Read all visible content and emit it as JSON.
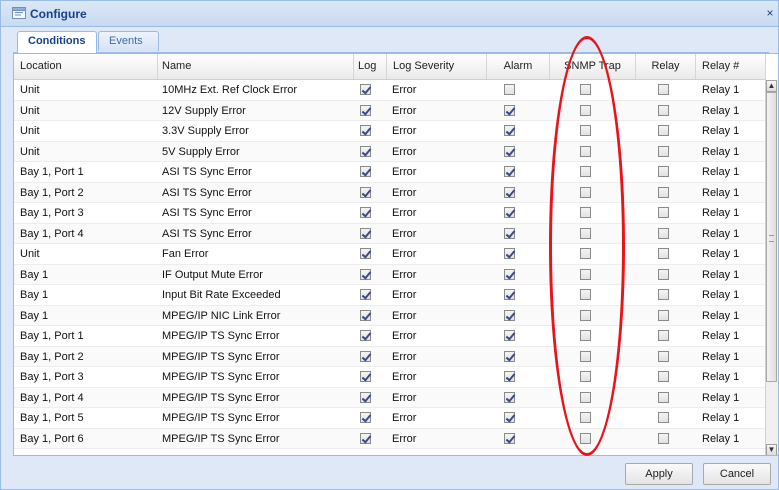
{
  "window": {
    "title": "Configure",
    "close_glyph": "×",
    "title_icon": "configure-window-icon"
  },
  "tabs": [
    {
      "label": "Conditions",
      "active": true
    },
    {
      "label": "Events",
      "active": false
    }
  ],
  "columns": {
    "location": "Location",
    "name": "Name",
    "log": "Log",
    "log_severity": "Log Severity",
    "alarm": "Alarm",
    "snmp_trap": "SNMP Trap",
    "relay": "Relay",
    "relay_num": "Relay #"
  },
  "rows": [
    {
      "location": "Unit",
      "name": "10MHz Ext. Ref Clock Error",
      "log": true,
      "severity": "Error",
      "alarm": false,
      "snmp": false,
      "relay": false,
      "relay_num": "Relay 1"
    },
    {
      "location": "Unit",
      "name": "12V Supply Error",
      "log": true,
      "severity": "Error",
      "alarm": true,
      "snmp": false,
      "relay": false,
      "relay_num": "Relay 1"
    },
    {
      "location": "Unit",
      "name": "3.3V Supply Error",
      "log": true,
      "severity": "Error",
      "alarm": true,
      "snmp": false,
      "relay": false,
      "relay_num": "Relay 1"
    },
    {
      "location": "Unit",
      "name": "5V Supply Error",
      "log": true,
      "severity": "Error",
      "alarm": true,
      "snmp": false,
      "relay": false,
      "relay_num": "Relay 1"
    },
    {
      "location": "Bay 1, Port 1",
      "name": "ASI TS Sync Error",
      "log": true,
      "severity": "Error",
      "alarm": true,
      "snmp": false,
      "relay": false,
      "relay_num": "Relay 1"
    },
    {
      "location": "Bay 1, Port 2",
      "name": "ASI TS Sync Error",
      "log": true,
      "severity": "Error",
      "alarm": true,
      "snmp": false,
      "relay": false,
      "relay_num": "Relay 1"
    },
    {
      "location": "Bay 1, Port 3",
      "name": "ASI TS Sync Error",
      "log": true,
      "severity": "Error",
      "alarm": true,
      "snmp": false,
      "relay": false,
      "relay_num": "Relay 1"
    },
    {
      "location": "Bay 1, Port 4",
      "name": "ASI TS Sync Error",
      "log": true,
      "severity": "Error",
      "alarm": true,
      "snmp": false,
      "relay": false,
      "relay_num": "Relay 1"
    },
    {
      "location": "Unit",
      "name": "Fan Error",
      "log": true,
      "severity": "Error",
      "alarm": true,
      "snmp": false,
      "relay": false,
      "relay_num": "Relay 1"
    },
    {
      "location": "Bay 1",
      "name": "IF Output Mute Error",
      "log": true,
      "severity": "Error",
      "alarm": true,
      "snmp": false,
      "relay": false,
      "relay_num": "Relay 1"
    },
    {
      "location": "Bay 1",
      "name": "Input Bit Rate Exceeded",
      "log": true,
      "severity": "Error",
      "alarm": true,
      "snmp": false,
      "relay": false,
      "relay_num": "Relay 1"
    },
    {
      "location": "Bay 1",
      "name": "MPEG/IP NIC Link Error",
      "log": true,
      "severity": "Error",
      "alarm": true,
      "snmp": false,
      "relay": false,
      "relay_num": "Relay 1"
    },
    {
      "location": "Bay 1, Port 1",
      "name": "MPEG/IP TS Sync Error",
      "log": true,
      "severity": "Error",
      "alarm": true,
      "snmp": false,
      "relay": false,
      "relay_num": "Relay 1"
    },
    {
      "location": "Bay 1, Port 2",
      "name": "MPEG/IP TS Sync Error",
      "log": true,
      "severity": "Error",
      "alarm": true,
      "snmp": false,
      "relay": false,
      "relay_num": "Relay 1"
    },
    {
      "location": "Bay 1, Port 3",
      "name": "MPEG/IP TS Sync Error",
      "log": true,
      "severity": "Error",
      "alarm": true,
      "snmp": false,
      "relay": false,
      "relay_num": "Relay 1"
    },
    {
      "location": "Bay 1, Port 4",
      "name": "MPEG/IP TS Sync Error",
      "log": true,
      "severity": "Error",
      "alarm": true,
      "snmp": false,
      "relay": false,
      "relay_num": "Relay 1"
    },
    {
      "location": "Bay 1, Port 5",
      "name": "MPEG/IP TS Sync Error",
      "log": true,
      "severity": "Error",
      "alarm": true,
      "snmp": false,
      "relay": false,
      "relay_num": "Relay 1"
    },
    {
      "location": "Bay 1, Port 6",
      "name": "MPEG/IP TS Sync Error",
      "log": true,
      "severity": "Error",
      "alarm": true,
      "snmp": false,
      "relay": false,
      "relay_num": "Relay 1"
    }
  ],
  "buttons": {
    "apply": "Apply",
    "cancel": "Cancel"
  },
  "colors": {
    "title_text": "#15428b",
    "panel_background": "#dfe8f6",
    "highlight": "#e8141c"
  }
}
